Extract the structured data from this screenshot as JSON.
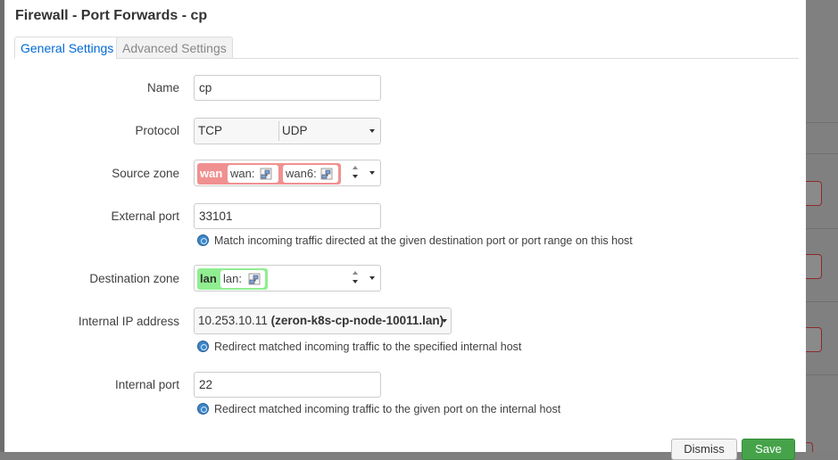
{
  "modal": {
    "title": "Firewall - Port Forwards - cp"
  },
  "tabs": [
    {
      "label": "General Settings",
      "active": true
    },
    {
      "label": "Advanced Settings",
      "active": false
    }
  ],
  "fields": {
    "name": {
      "label": "Name",
      "value": "cp"
    },
    "protocol": {
      "label": "Protocol",
      "options": [
        "TCP",
        "UDP"
      ]
    },
    "source_zone": {
      "label": "Source zone",
      "zone": "wan",
      "networks": [
        "wan:",
        "wan6:"
      ],
      "color": "#f09090"
    },
    "external_port": {
      "label": "External port",
      "value": "33101",
      "help": "Match incoming traffic directed at the given destination port or port range on this host"
    },
    "destination_zone": {
      "label": "Destination zone",
      "zone": "lan",
      "networks": [
        "lan:"
      ],
      "color": "#90ee90"
    },
    "internal_ip": {
      "label": "Internal IP address",
      "ip": "10.253.10.11",
      "host": "(zeron-k8s-cp-node-10011.lan)",
      "help": "Redirect matched incoming traffic to the specified internal host"
    },
    "internal_port": {
      "label": "Internal port",
      "value": "22",
      "help": "Redirect matched incoming traffic to the given port on the internal host"
    }
  },
  "buttons": {
    "dismiss": "Dismiss",
    "save": "Save"
  },
  "icons": {
    "network": "network-icon",
    "help": "info-icon",
    "dropdown": "caret-down-icon"
  }
}
